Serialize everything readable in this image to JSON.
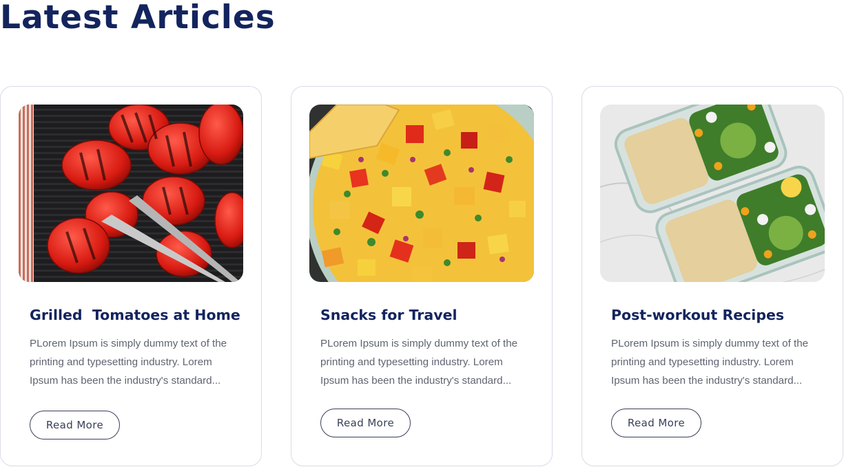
{
  "section": {
    "title": "Latest Articles"
  },
  "articles": [
    {
      "title": "Grilled  Tomatoes at Home",
      "excerpt": "PLorem Ipsum is simply dummy text of the printing and typesetting industry. Lorem Ipsum has been the industry's standard...",
      "button_label": "Read More",
      "image": "grilled-tomatoes-photo"
    },
    {
      "title": "Snacks for Travel",
      "excerpt": "PLorem Ipsum is simply dummy text of the printing and typesetting industry. Lorem Ipsum has been the industry's standard...",
      "button_label": "Read More",
      "image": "fruit-salsa-photo"
    },
    {
      "title": "Post-workout Recipes",
      "excerpt": "PLorem Ipsum is simply dummy text of the printing and typesetting industry. Lorem Ipsum has been the industry's standard...",
      "button_label": "Read More",
      "image": "meal-prep-photo"
    }
  ],
  "colors": {
    "heading": "#13245e",
    "body_text": "#5f6470",
    "card_border": "#d9dbe7",
    "button_border": "#3a3f58"
  }
}
